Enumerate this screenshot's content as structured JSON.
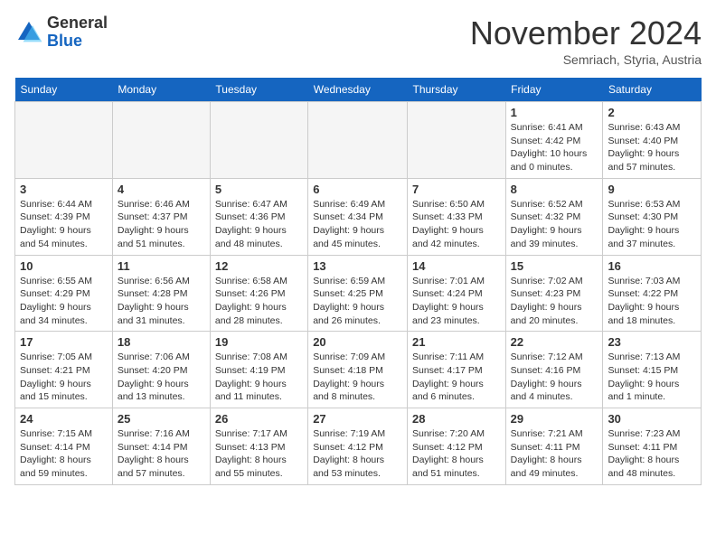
{
  "header": {
    "logo_line1": "General",
    "logo_line2": "Blue",
    "month": "November 2024",
    "location": "Semriach, Styria, Austria"
  },
  "weekdays": [
    "Sunday",
    "Monday",
    "Tuesday",
    "Wednesday",
    "Thursday",
    "Friday",
    "Saturday"
  ],
  "weeks": [
    [
      {
        "day": "",
        "info": ""
      },
      {
        "day": "",
        "info": ""
      },
      {
        "day": "",
        "info": ""
      },
      {
        "day": "",
        "info": ""
      },
      {
        "day": "",
        "info": ""
      },
      {
        "day": "1",
        "info": "Sunrise: 6:41 AM\nSunset: 4:42 PM\nDaylight: 10 hours\nand 0 minutes."
      },
      {
        "day": "2",
        "info": "Sunrise: 6:43 AM\nSunset: 4:40 PM\nDaylight: 9 hours\nand 57 minutes."
      }
    ],
    [
      {
        "day": "3",
        "info": "Sunrise: 6:44 AM\nSunset: 4:39 PM\nDaylight: 9 hours\nand 54 minutes."
      },
      {
        "day": "4",
        "info": "Sunrise: 6:46 AM\nSunset: 4:37 PM\nDaylight: 9 hours\nand 51 minutes."
      },
      {
        "day": "5",
        "info": "Sunrise: 6:47 AM\nSunset: 4:36 PM\nDaylight: 9 hours\nand 48 minutes."
      },
      {
        "day": "6",
        "info": "Sunrise: 6:49 AM\nSunset: 4:34 PM\nDaylight: 9 hours\nand 45 minutes."
      },
      {
        "day": "7",
        "info": "Sunrise: 6:50 AM\nSunset: 4:33 PM\nDaylight: 9 hours\nand 42 minutes."
      },
      {
        "day": "8",
        "info": "Sunrise: 6:52 AM\nSunset: 4:32 PM\nDaylight: 9 hours\nand 39 minutes."
      },
      {
        "day": "9",
        "info": "Sunrise: 6:53 AM\nSunset: 4:30 PM\nDaylight: 9 hours\nand 37 minutes."
      }
    ],
    [
      {
        "day": "10",
        "info": "Sunrise: 6:55 AM\nSunset: 4:29 PM\nDaylight: 9 hours\nand 34 minutes."
      },
      {
        "day": "11",
        "info": "Sunrise: 6:56 AM\nSunset: 4:28 PM\nDaylight: 9 hours\nand 31 minutes."
      },
      {
        "day": "12",
        "info": "Sunrise: 6:58 AM\nSunset: 4:26 PM\nDaylight: 9 hours\nand 28 minutes."
      },
      {
        "day": "13",
        "info": "Sunrise: 6:59 AM\nSunset: 4:25 PM\nDaylight: 9 hours\nand 26 minutes."
      },
      {
        "day": "14",
        "info": "Sunrise: 7:01 AM\nSunset: 4:24 PM\nDaylight: 9 hours\nand 23 minutes."
      },
      {
        "day": "15",
        "info": "Sunrise: 7:02 AM\nSunset: 4:23 PM\nDaylight: 9 hours\nand 20 minutes."
      },
      {
        "day": "16",
        "info": "Sunrise: 7:03 AM\nSunset: 4:22 PM\nDaylight: 9 hours\nand 18 minutes."
      }
    ],
    [
      {
        "day": "17",
        "info": "Sunrise: 7:05 AM\nSunset: 4:21 PM\nDaylight: 9 hours\nand 15 minutes."
      },
      {
        "day": "18",
        "info": "Sunrise: 7:06 AM\nSunset: 4:20 PM\nDaylight: 9 hours\nand 13 minutes."
      },
      {
        "day": "19",
        "info": "Sunrise: 7:08 AM\nSunset: 4:19 PM\nDaylight: 9 hours\nand 11 minutes."
      },
      {
        "day": "20",
        "info": "Sunrise: 7:09 AM\nSunset: 4:18 PM\nDaylight: 9 hours\nand 8 minutes."
      },
      {
        "day": "21",
        "info": "Sunrise: 7:11 AM\nSunset: 4:17 PM\nDaylight: 9 hours\nand 6 minutes."
      },
      {
        "day": "22",
        "info": "Sunrise: 7:12 AM\nSunset: 4:16 PM\nDaylight: 9 hours\nand 4 minutes."
      },
      {
        "day": "23",
        "info": "Sunrise: 7:13 AM\nSunset: 4:15 PM\nDaylight: 9 hours\nand 1 minute."
      }
    ],
    [
      {
        "day": "24",
        "info": "Sunrise: 7:15 AM\nSunset: 4:14 PM\nDaylight: 8 hours\nand 59 minutes."
      },
      {
        "day": "25",
        "info": "Sunrise: 7:16 AM\nSunset: 4:14 PM\nDaylight: 8 hours\nand 57 minutes."
      },
      {
        "day": "26",
        "info": "Sunrise: 7:17 AM\nSunset: 4:13 PM\nDaylight: 8 hours\nand 55 minutes."
      },
      {
        "day": "27",
        "info": "Sunrise: 7:19 AM\nSunset: 4:12 PM\nDaylight: 8 hours\nand 53 minutes."
      },
      {
        "day": "28",
        "info": "Sunrise: 7:20 AM\nSunset: 4:12 PM\nDaylight: 8 hours\nand 51 minutes."
      },
      {
        "day": "29",
        "info": "Sunrise: 7:21 AM\nSunset: 4:11 PM\nDaylight: 8 hours\nand 49 minutes."
      },
      {
        "day": "30",
        "info": "Sunrise: 7:23 AM\nSunset: 4:11 PM\nDaylight: 8 hours\nand 48 minutes."
      }
    ]
  ]
}
